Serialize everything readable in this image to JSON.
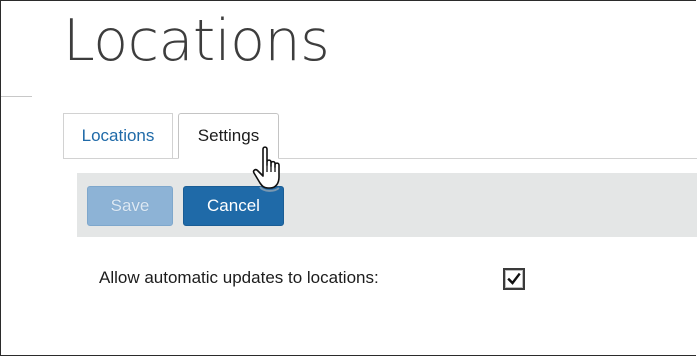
{
  "page": {
    "title": "Locations"
  },
  "tabs": [
    {
      "label": "Locations",
      "active": false
    },
    {
      "label": "Settings",
      "active": true
    }
  ],
  "toolbar": {
    "save_label": "Save",
    "save_enabled": false,
    "cancel_label": "Cancel"
  },
  "settings": {
    "auto_update_label": "Allow automatic updates to locations:",
    "auto_update_checked": true
  },
  "cursor": {
    "type": "hand-pointer"
  },
  "colors": {
    "link_blue": "#1f6aa8",
    "toolbar_bg": "#e4e6e6",
    "disabled_button": "#8db3d6"
  }
}
